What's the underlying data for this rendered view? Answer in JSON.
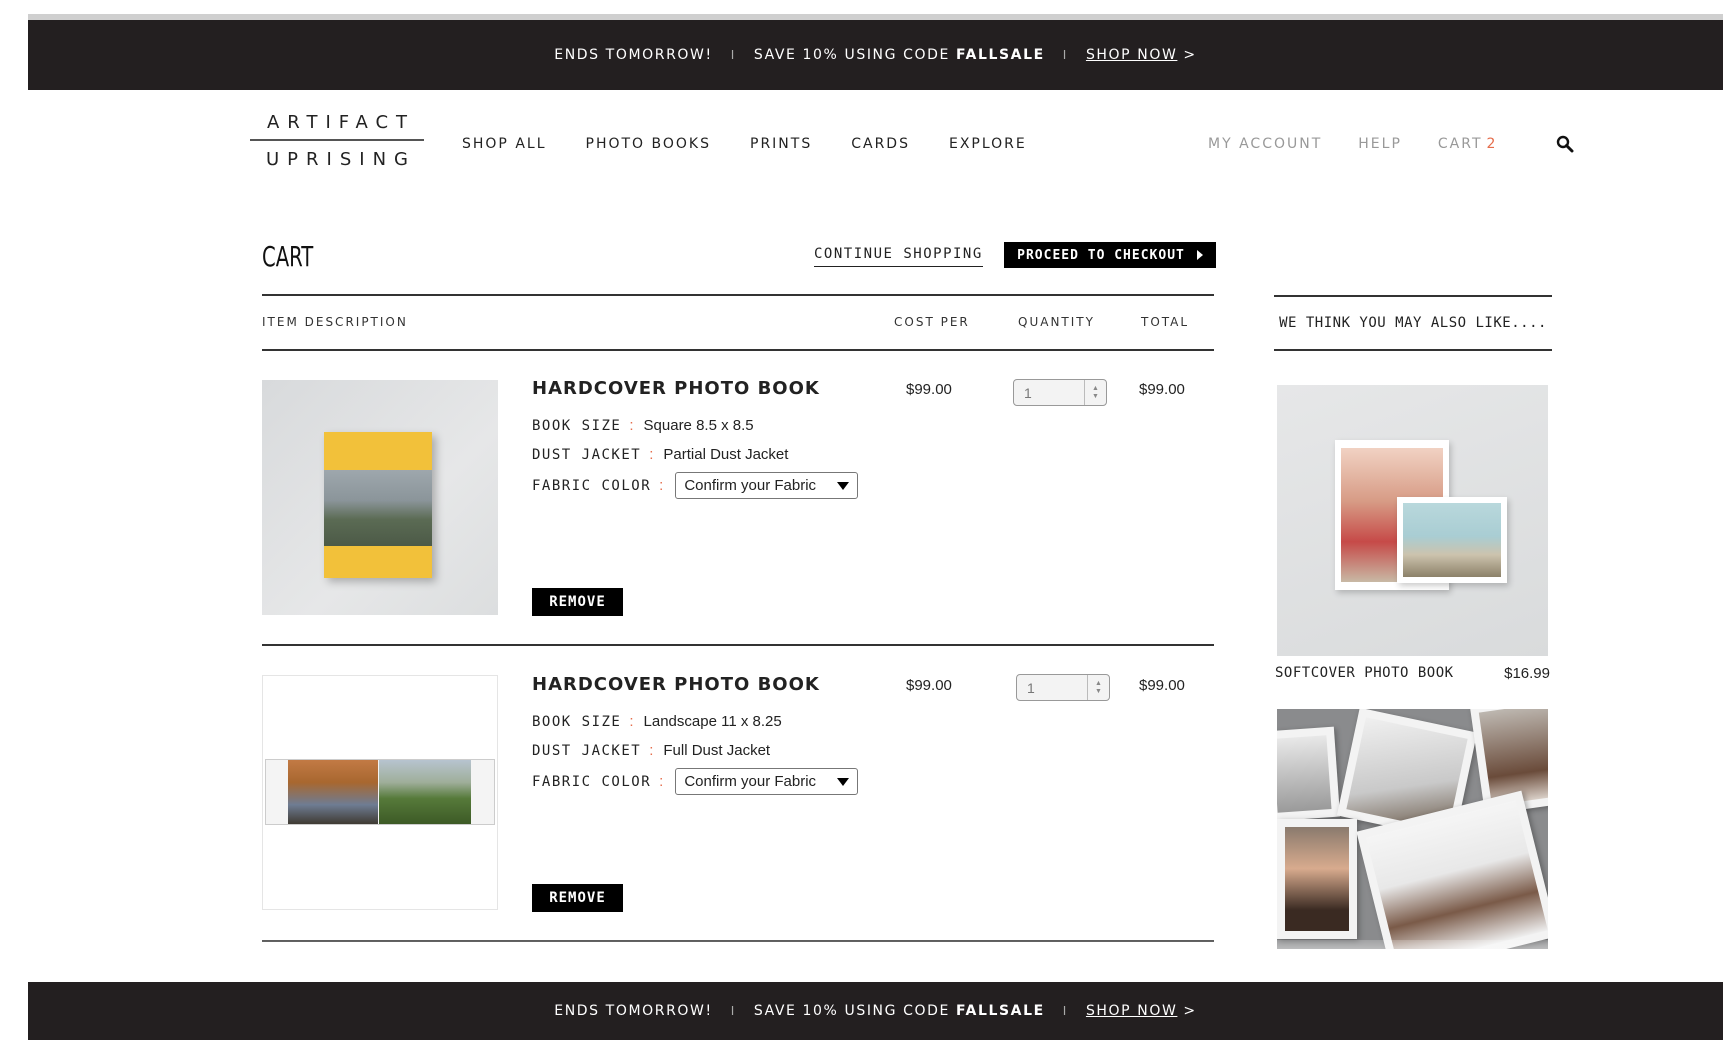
{
  "promo": {
    "ends": "ENDS TOMORROW!",
    "sep": "I",
    "save": "SAVE 10% USING CODE",
    "code": "FALLSALE",
    "shop": "SHOP NOW",
    "chev": ">"
  },
  "logo": {
    "line1": "ARTIFACT",
    "line2": "UPRISING"
  },
  "nav": [
    "SHOP ALL",
    "PHOTO BOOKS",
    "PRINTS",
    "CARDS",
    "EXPLORE"
  ],
  "util": {
    "account": "MY ACCOUNT",
    "help": "HELP",
    "cart": "CART",
    "cart_count": "2"
  },
  "cart": {
    "title": "CART",
    "continue": "CONTINUE SHOPPING",
    "checkout": "PROCEED TO CHECKOUT",
    "columns": {
      "item": "ITEM DESCRIPTION",
      "cost": "COST PER",
      "qty": "QUANTITY",
      "total": "TOTAL"
    },
    "items": [
      {
        "title": "HARDCOVER PHOTO BOOK",
        "size_label": "BOOK SIZE",
        "size": "Square 8.5 x 8.5",
        "jacket_label": "DUST JACKET",
        "jacket": "Partial Dust Jacket",
        "fabric_label": "FABRIC COLOR",
        "fabric": "Confirm your Fabric",
        "cost": "$99.00",
        "qty": "1",
        "total": "$99.00",
        "remove": "REMOVE"
      },
      {
        "title": "HARDCOVER PHOTO BOOK",
        "size_label": "BOOK SIZE",
        "size": "Landscape 11 x 8.25",
        "jacket_label": "DUST JACKET",
        "jacket": "Full Dust Jacket",
        "fabric_label": "FABRIC COLOR",
        "fabric": "Confirm your Fabric",
        "cost": "$99.00",
        "qty": "1",
        "total": "$99.00",
        "remove": "REMOVE"
      }
    ],
    "colon": ":"
  },
  "sidebar": {
    "title": "WE THINK YOU MAY ALSO LIKE....",
    "recs": [
      {
        "name": "SOFTCOVER PHOTO BOOK",
        "price": "$16.99"
      }
    ]
  },
  "colors": {
    "promo_bg": "#231f20",
    "accent": "#e56d4c",
    "button": "#000000"
  },
  "icons": [
    "search-icon",
    "caret-down-icon",
    "spinner-icon",
    "play-right-icon"
  ]
}
